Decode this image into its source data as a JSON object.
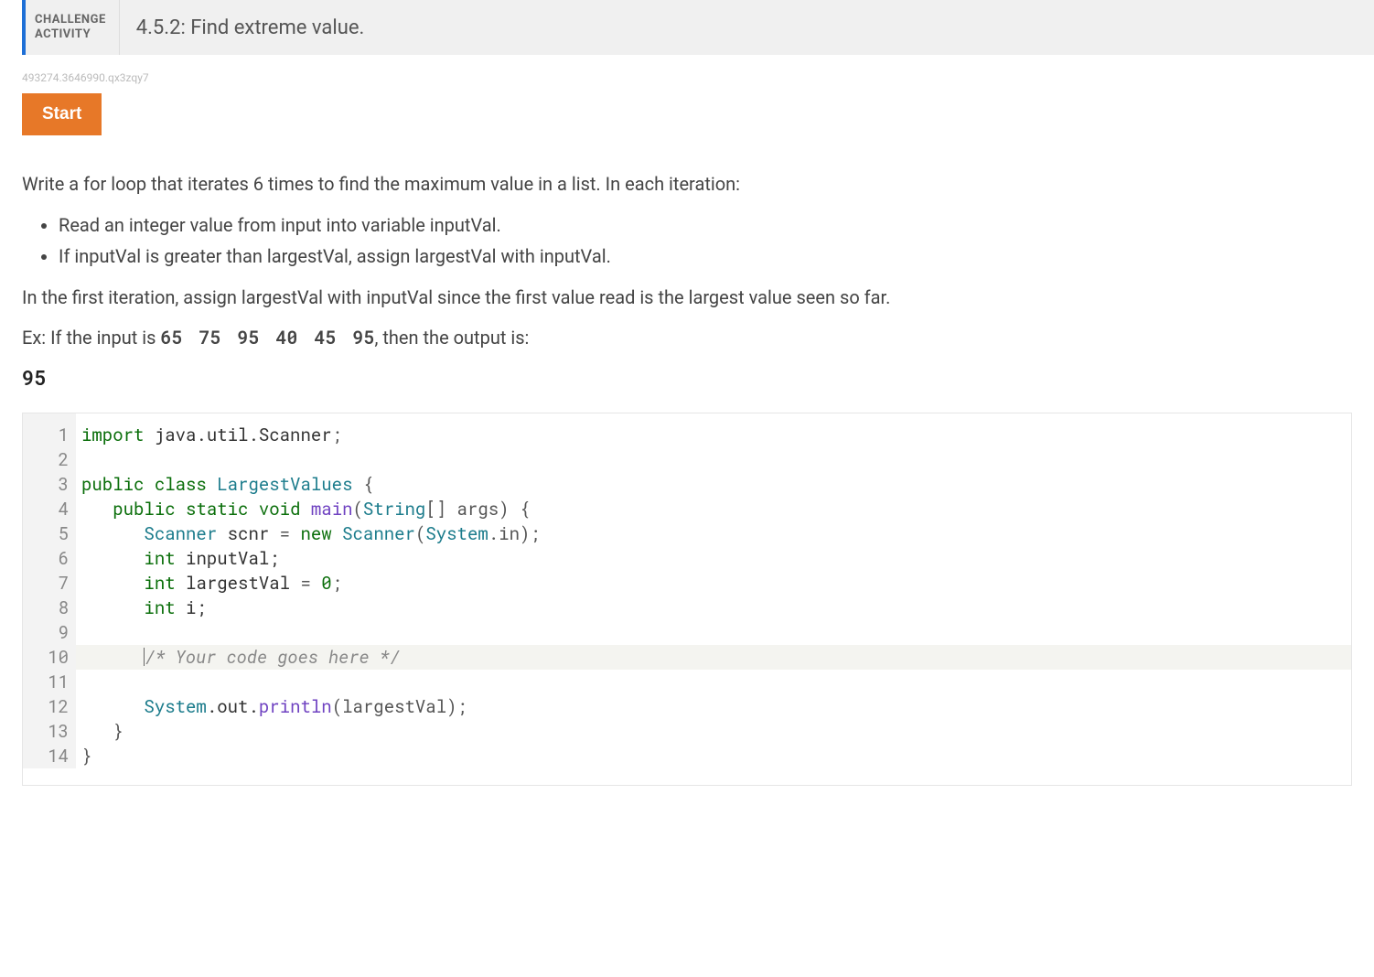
{
  "header": {
    "label": "CHALLENGE\nACTIVITY",
    "title": "4.5.2: Find extreme value."
  },
  "meta_id": "493274.3646990.qx3zqy7",
  "buttons": {
    "start": "Start"
  },
  "instructions": {
    "intro": "Write a for loop that iterates 6 times to find the maximum value in a list. In each iteration:",
    "bullets": [
      "Read an integer value from input into variable inputVal.",
      "If inputVal is greater than largestVal, assign largestVal with inputVal."
    ],
    "after": "In the first iteration, assign largestVal with inputVal since the first value read is the largest value seen so far.",
    "example_prefix": "Ex: If the input is ",
    "example_input": "65 75 95 40 45 95",
    "example_suffix": ", then the output is:",
    "example_output": "95"
  },
  "code": {
    "highlight_line": 10,
    "lines": [
      {
        "n": 1,
        "tokens": [
          {
            "t": "import",
            "c": "kw"
          },
          {
            "t": " ",
            "c": "plain"
          },
          {
            "t": "java.util.Scanner",
            "c": "plain"
          },
          {
            "t": ";",
            "c": "punc"
          }
        ]
      },
      {
        "n": 2,
        "tokens": []
      },
      {
        "n": 3,
        "tokens": [
          {
            "t": "public",
            "c": "kw"
          },
          {
            "t": " ",
            "c": "plain"
          },
          {
            "t": "class",
            "c": "kw"
          },
          {
            "t": " ",
            "c": "plain"
          },
          {
            "t": "LargestValues",
            "c": "type"
          },
          {
            "t": " {",
            "c": "punc"
          }
        ]
      },
      {
        "n": 4,
        "tokens": [
          {
            "t": "   ",
            "c": "plain"
          },
          {
            "t": "public",
            "c": "kw"
          },
          {
            "t": " ",
            "c": "plain"
          },
          {
            "t": "static",
            "c": "kw"
          },
          {
            "t": " ",
            "c": "plain"
          },
          {
            "t": "void",
            "c": "kw"
          },
          {
            "t": " ",
            "c": "plain"
          },
          {
            "t": "main",
            "c": "fn"
          },
          {
            "t": "(",
            "c": "punc"
          },
          {
            "t": "String",
            "c": "type"
          },
          {
            "t": "[] args) {",
            "c": "punc"
          }
        ]
      },
      {
        "n": 5,
        "tokens": [
          {
            "t": "      ",
            "c": "plain"
          },
          {
            "t": "Scanner",
            "c": "type"
          },
          {
            "t": " scnr ",
            "c": "plain"
          },
          {
            "t": "=",
            "c": "punc"
          },
          {
            "t": " ",
            "c": "plain"
          },
          {
            "t": "new",
            "c": "kw"
          },
          {
            "t": " ",
            "c": "plain"
          },
          {
            "t": "Scanner",
            "c": "type"
          },
          {
            "t": "(",
            "c": "punc"
          },
          {
            "t": "System",
            "c": "ident"
          },
          {
            "t": ".in);",
            "c": "punc"
          }
        ]
      },
      {
        "n": 6,
        "tokens": [
          {
            "t": "      ",
            "c": "plain"
          },
          {
            "t": "int",
            "c": "kw"
          },
          {
            "t": " inputVal;",
            "c": "plain"
          }
        ]
      },
      {
        "n": 7,
        "tokens": [
          {
            "t": "      ",
            "c": "plain"
          },
          {
            "t": "int",
            "c": "kw"
          },
          {
            "t": " largestVal ",
            "c": "plain"
          },
          {
            "t": "=",
            "c": "punc"
          },
          {
            "t": " ",
            "c": "plain"
          },
          {
            "t": "0",
            "c": "num"
          },
          {
            "t": ";",
            "c": "punc"
          }
        ]
      },
      {
        "n": 8,
        "tokens": [
          {
            "t": "      ",
            "c": "plain"
          },
          {
            "t": "int",
            "c": "kw"
          },
          {
            "t": " i;",
            "c": "plain"
          }
        ]
      },
      {
        "n": 9,
        "tokens": []
      },
      {
        "n": 10,
        "tokens": [
          {
            "t": "      ",
            "c": "plain"
          },
          {
            "caret": true
          },
          {
            "t": "/* Your code goes here */",
            "c": "comment"
          }
        ]
      },
      {
        "n": 11,
        "tokens": []
      },
      {
        "n": 12,
        "tokens": [
          {
            "t": "      ",
            "c": "plain"
          },
          {
            "t": "System",
            "c": "ident"
          },
          {
            "t": ".out.",
            "c": "plain"
          },
          {
            "t": "println",
            "c": "fn"
          },
          {
            "t": "(largestVal);",
            "c": "punc"
          }
        ]
      },
      {
        "n": 13,
        "tokens": [
          {
            "t": "   }",
            "c": "punc"
          }
        ]
      },
      {
        "n": 14,
        "tokens": [
          {
            "t": "}",
            "c": "punc"
          }
        ]
      }
    ]
  }
}
